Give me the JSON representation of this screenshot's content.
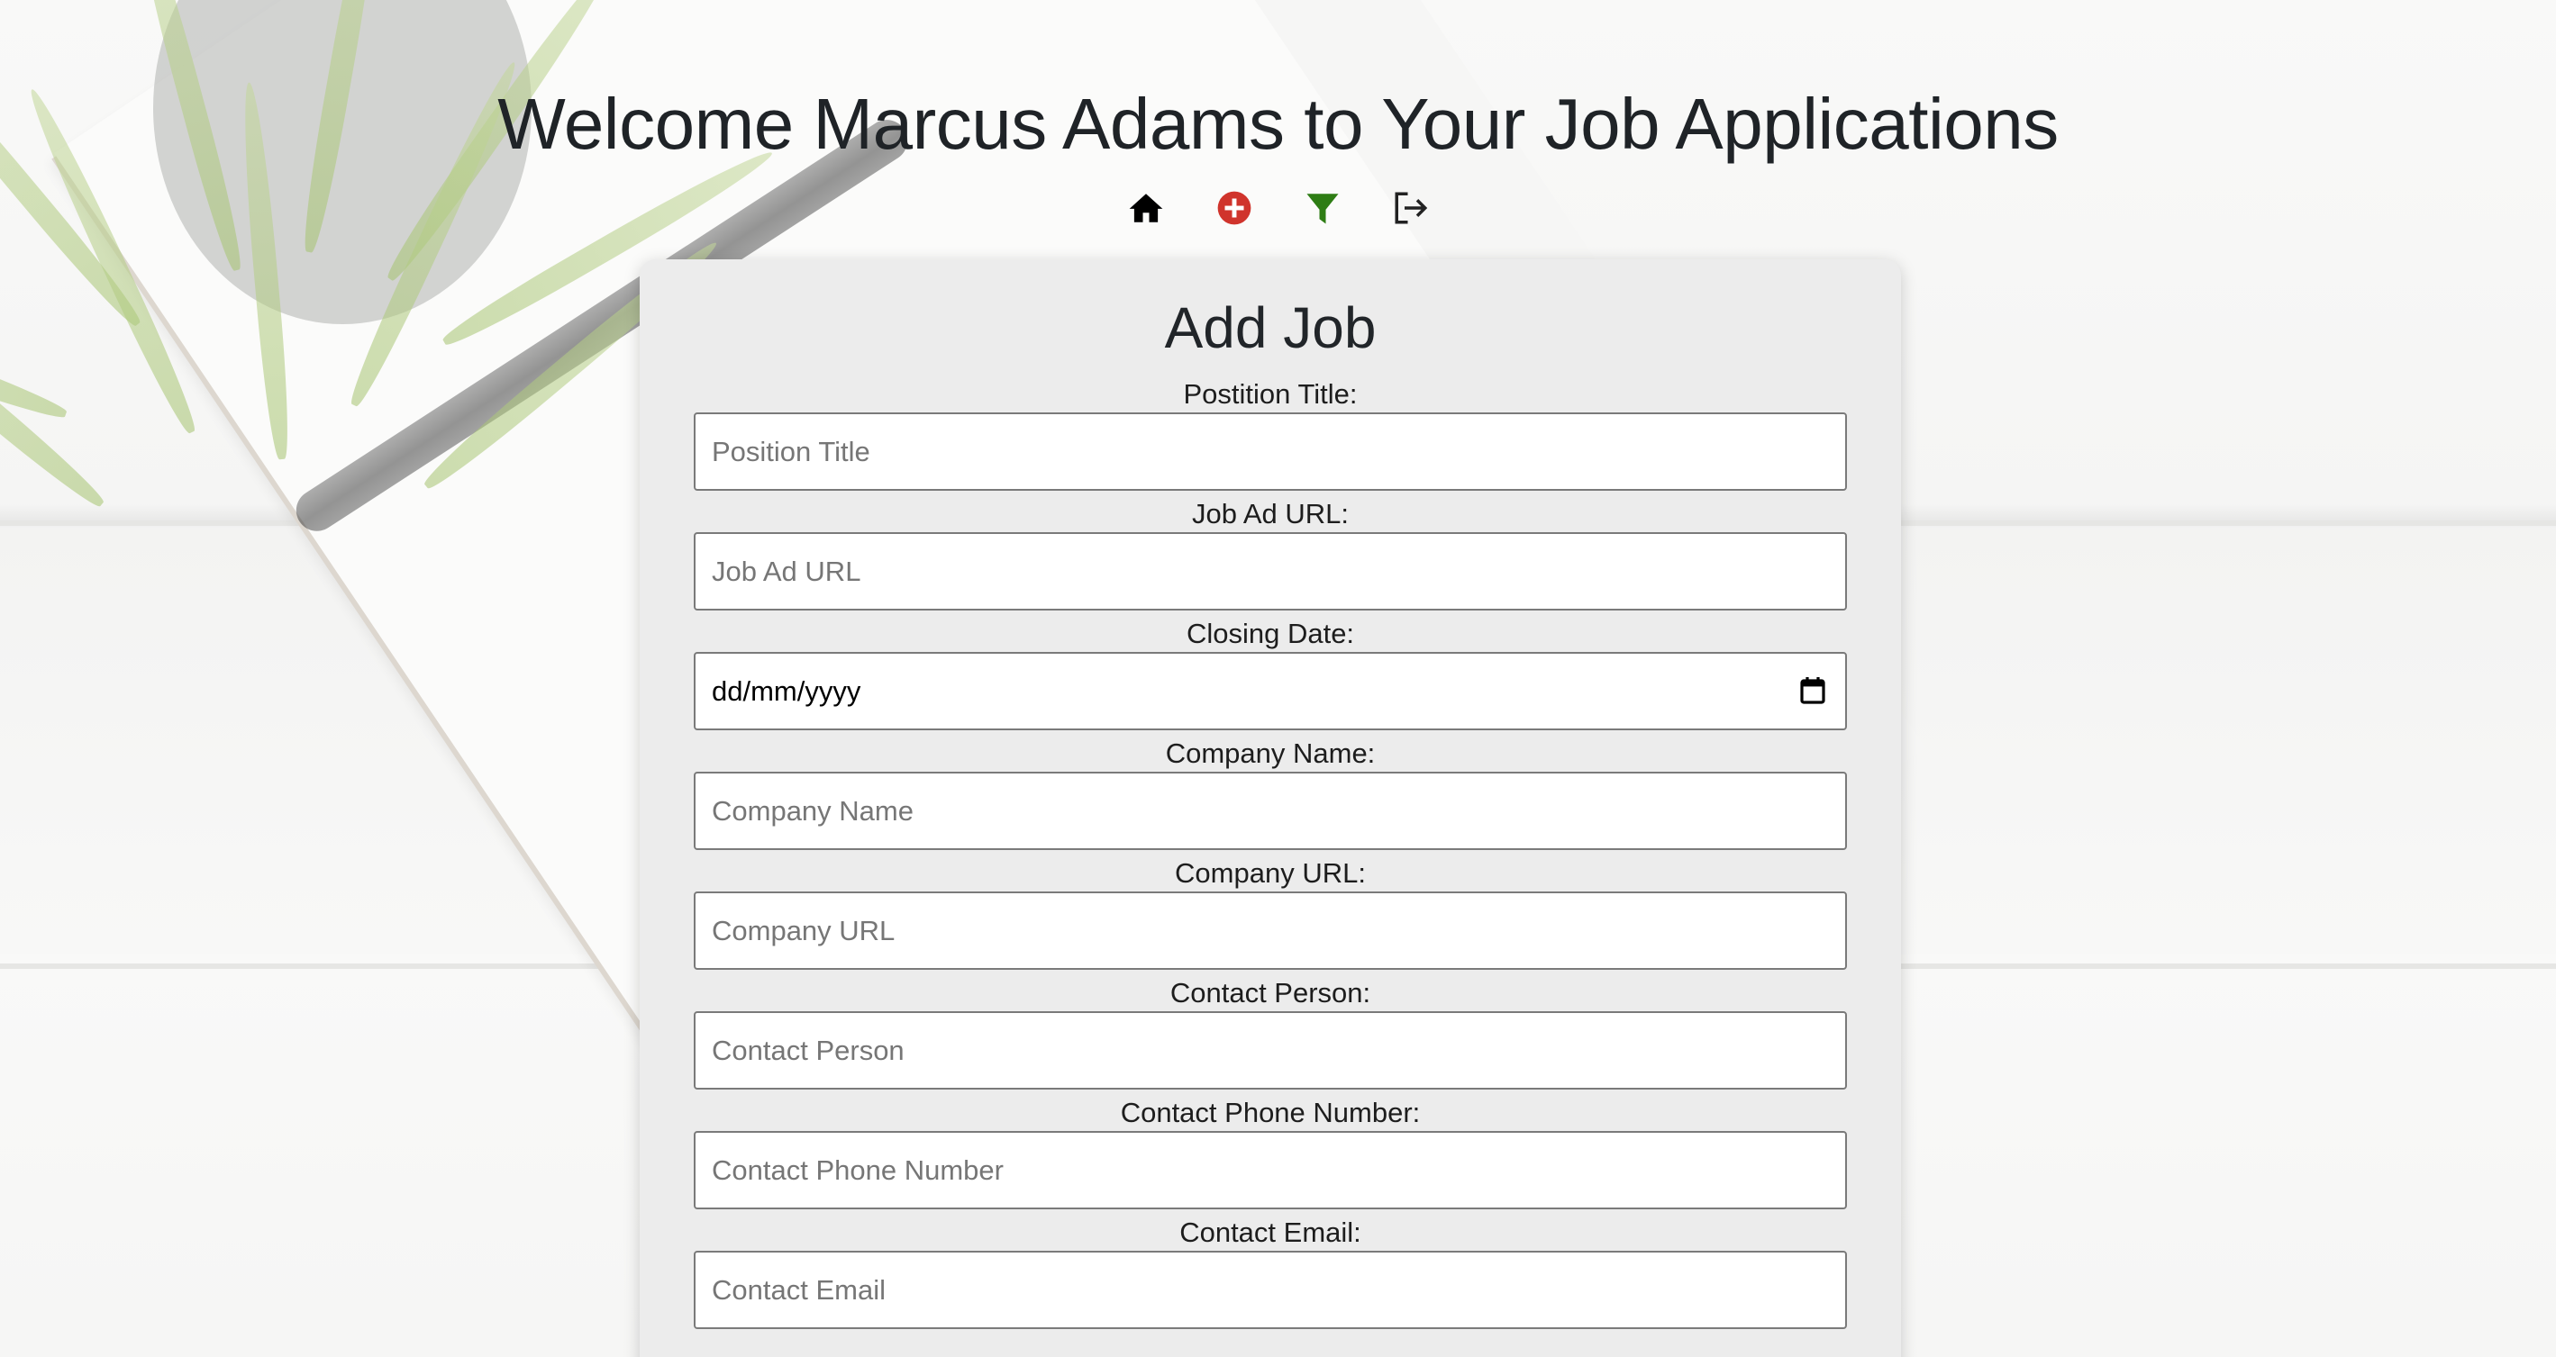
{
  "header": {
    "title": "Welcome Marcus Adams to Your Job Applications"
  },
  "nav": [
    {
      "name": "home",
      "icon": "home-icon",
      "color": "#000000"
    },
    {
      "name": "add-job",
      "icon": "plus-circle-icon",
      "color": "#d0342c"
    },
    {
      "name": "filter",
      "icon": "filter-icon",
      "color": "#2e7d14"
    },
    {
      "name": "logout",
      "icon": "logout-icon",
      "color": "#222222"
    }
  ],
  "form": {
    "title": "Add Job",
    "fields": [
      {
        "label": "Postition Title:",
        "placeholder": "Position Title",
        "type": "text"
      },
      {
        "label": "Job Ad URL:",
        "placeholder": "Job Ad URL",
        "type": "text"
      },
      {
        "label": "Closing Date:",
        "value": "dd/mm/yyyy",
        "type": "date"
      },
      {
        "label": "Company Name:",
        "placeholder": "Company Name",
        "type": "text"
      },
      {
        "label": "Company URL:",
        "placeholder": "Company URL",
        "type": "text"
      },
      {
        "label": "Contact Person:",
        "placeholder": "Contact Person",
        "type": "text"
      },
      {
        "label": "Contact Phone Number:",
        "placeholder": "Contact Phone Number",
        "type": "text"
      },
      {
        "label": "Contact Email:",
        "placeholder": "Contact Email",
        "type": "text"
      }
    ]
  }
}
